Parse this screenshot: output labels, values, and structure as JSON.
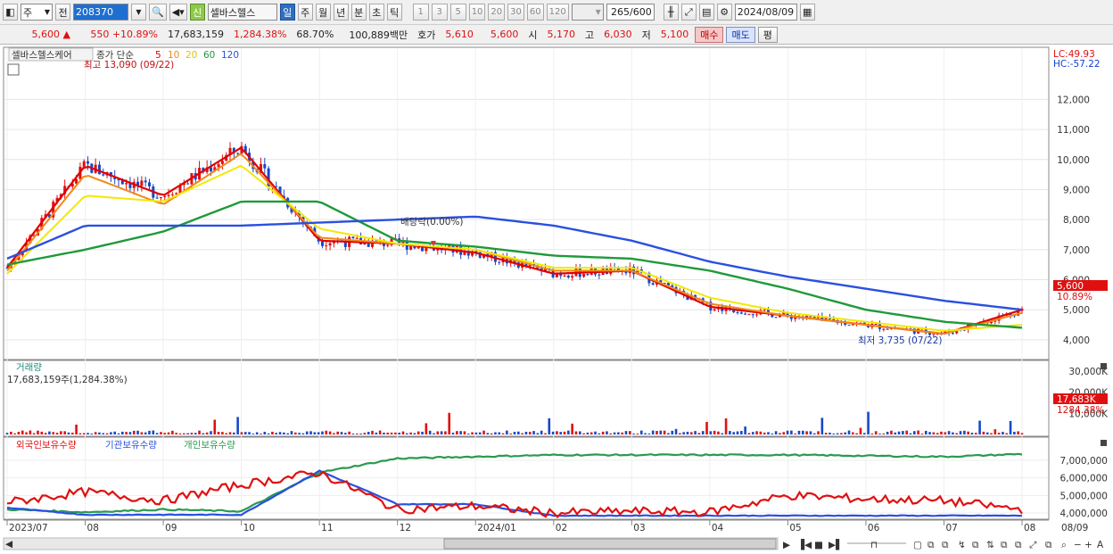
{
  "toolbar": {
    "period_type": "주",
    "prev_label": "전",
    "stock_code": "208370",
    "stock_name": "셀바스헬스",
    "new_badge": "신",
    "tabs": [
      "일",
      "주",
      "월",
      "년",
      "분",
      "초",
      "틱"
    ],
    "active_tab": "일",
    "intervals": [
      "1",
      "3",
      "5",
      "10",
      "20",
      "30",
      "60",
      "120"
    ],
    "count_current": "265",
    "count_total": "/600",
    "date": "2024/08/09"
  },
  "quote": {
    "price": "5,600",
    "change_arrow": "▲",
    "change": "550",
    "change_pct": "+10.89%",
    "volume": "17,683,159",
    "volume_pct": "1,284.38%",
    "turnover": "68.70%",
    "amount": "100,889백만",
    "ask_label": "호가",
    "ask1": "5,610",
    "ask2": "5,600",
    "open_label": "시",
    "open": "5,170",
    "high_label": "고",
    "high": "6,030",
    "low_label": "저",
    "low": "5,100",
    "buy_label": "매수",
    "sell_label": "매도",
    "eval_label": "평"
  },
  "price_panel": {
    "stock_label": "셀바스헬스케어",
    "ma_title": "종가 단순",
    "ma_periods": [
      "5",
      "10",
      "20",
      "60",
      "120"
    ],
    "high_annotation": "최고 13,090 (09/22)",
    "low_annotation": "최저 3,735 (07/22)",
    "dividend_annotation": "배당락(0.00%)",
    "lc": "LC:49.93",
    "hc": "HC:-57.22",
    "current_price_tag": "5,600",
    "current_pct_tag": "10.89%",
    "y_ticks": [
      "12,000",
      "11,000",
      "10,000",
      "9,000",
      "8,000",
      "7,000",
      "6,000",
      "5,000",
      "4,000"
    ]
  },
  "volume_panel": {
    "title": "거래량",
    "info": "17,683,159주(1,284.38%)",
    "y_ticks": [
      "30,000K",
      "20,000K",
      "10,000K"
    ],
    "tag": "17,683K",
    "tag_pct": "1284.38%"
  },
  "holding_panel": {
    "legend": [
      "외국인보유수량",
      "기관보유수량",
      "개인보유수량"
    ],
    "y_ticks": [
      "7,000,000",
      "6,000,000",
      "5,000,000",
      "4,000,000"
    ]
  },
  "x_axis": [
    "2023/07",
    "08",
    "09",
    "10",
    "11",
    "12",
    "2024/01",
    "02",
    "03",
    "04",
    "05",
    "06",
    "07",
    "08",
    "08/09"
  ],
  "colors": {
    "up": "#e01010",
    "down": "#1848c8",
    "ma5": "#e00000",
    "ma10": "#f08a18",
    "ma20": "#f2e800",
    "ma60": "#1f9a3a",
    "ma120": "#2a50e0",
    "foreign": "#e01010",
    "institution": "#2a50e0",
    "individual": "#2a9a50"
  },
  "chart_data": {
    "type": "line",
    "title": "셀바스헬스케어",
    "x": [
      "2023/07",
      "08",
      "09",
      "10",
      "11",
      "12",
      "2024/01",
      "02",
      "03",
      "04",
      "05",
      "06",
      "07",
      "08"
    ],
    "series": [
      {
        "name": "5",
        "values": [
          6400,
          9800,
          8800,
          10400,
          7300,
          7200,
          6900,
          6200,
          6300,
          5100,
          4800,
          4500,
          4200,
          5000
        ]
      },
      {
        "name": "10",
        "values": [
          6300,
          9500,
          8500,
          10200,
          7400,
          7200,
          7000,
          6300,
          6300,
          5200,
          4800,
          4500,
          4200,
          4900
        ]
      },
      {
        "name": "20",
        "values": [
          6200,
          8800,
          8600,
          9800,
          7700,
          7200,
          7000,
          6400,
          6400,
          5400,
          4900,
          4600,
          4300,
          4500
        ]
      },
      {
        "name": "60",
        "values": [
          6500,
          7000,
          7600,
          8600,
          8600,
          7300,
          7100,
          6800,
          6700,
          6300,
          5700,
          5000,
          4600,
          4400
        ]
      },
      {
        "name": "120",
        "values": [
          6700,
          7800,
          7800,
          7800,
          7900,
          8000,
          8100,
          7800,
          7300,
          6600,
          6100,
          5700,
          5300,
          5000
        ]
      }
    ],
    "ylim": [
      3700,
      13200
    ]
  }
}
